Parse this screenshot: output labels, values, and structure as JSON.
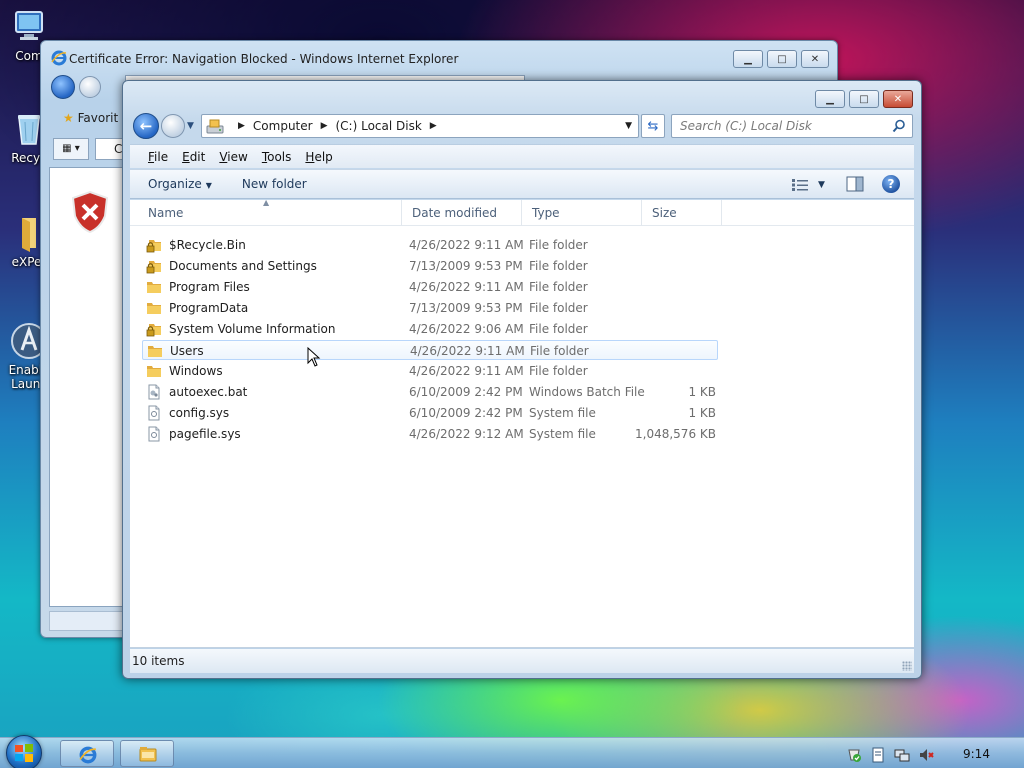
{
  "desktop": {
    "icons": [
      {
        "label": "Com",
        "icon": "computer-icon"
      },
      {
        "label": "Recyc",
        "icon": "recycle-bin-icon"
      },
      {
        "label": "eXPer",
        "icon": "folder-icon"
      },
      {
        "label": "Enable",
        "label2": "Launc",
        "icon": "app-launcher-icon"
      }
    ]
  },
  "ie_window": {
    "title": "Certificate Error: Navigation Blocked - Windows Internet Explorer",
    "favorites_label": "Favorit",
    "tab_label": "C",
    "error_icon": "shield-error-icon"
  },
  "explorer": {
    "breadcrumbs": [
      "Computer",
      "(C:) Local Disk"
    ],
    "search_placeholder": "Search (C:) Local Disk",
    "menu": [
      {
        "label": "File",
        "key": "F",
        "rest": "ile"
      },
      {
        "label": "Edit",
        "key": "E",
        "rest": "dit"
      },
      {
        "label": "View",
        "key": "V",
        "rest": "iew"
      },
      {
        "label": "Tools",
        "key": "T",
        "rest": "ools"
      },
      {
        "label": "Help",
        "key": "H",
        "rest": "elp"
      }
    ],
    "commands": {
      "organize": "Organize",
      "new_folder": "New folder"
    },
    "columns": {
      "name": "Name",
      "date": "Date modified",
      "type": "Type",
      "size": "Size"
    },
    "files": [
      {
        "name": "$Recycle.Bin",
        "date": "4/26/2022 9:11 AM",
        "type": "File folder",
        "size": "",
        "icon": "locked-folder-icon"
      },
      {
        "name": "Documents and Settings",
        "date": "7/13/2009 9:53 PM",
        "type": "File folder",
        "size": "",
        "icon": "locked-folder-icon"
      },
      {
        "name": "Program Files",
        "date": "4/26/2022 9:11 AM",
        "type": "File folder",
        "size": "",
        "icon": "folder-icon"
      },
      {
        "name": "ProgramData",
        "date": "7/13/2009 9:53 PM",
        "type": "File folder",
        "size": "",
        "icon": "folder-icon"
      },
      {
        "name": "System Volume Information",
        "date": "4/26/2022 9:06 AM",
        "type": "File folder",
        "size": "",
        "icon": "locked-folder-icon"
      },
      {
        "name": "Users",
        "date": "4/26/2022 9:11 AM",
        "type": "File folder",
        "size": "",
        "icon": "folder-icon"
      },
      {
        "name": "Windows",
        "date": "4/26/2022 9:11 AM",
        "type": "File folder",
        "size": "",
        "icon": "folder-icon"
      },
      {
        "name": "autoexec.bat",
        "date": "6/10/2009 2:42 PM",
        "type": "Windows Batch File",
        "size": "1 KB",
        "icon": "batch-file-icon"
      },
      {
        "name": "config.sys",
        "date": "6/10/2009 2:42 PM",
        "type": "System file",
        "size": "1 KB",
        "icon": "system-file-icon"
      },
      {
        "name": "pagefile.sys",
        "date": "4/26/2022 9:12 AM",
        "type": "System file",
        "size": "1,048,576 KB",
        "icon": "system-file-icon"
      }
    ],
    "hovered_row": "Users",
    "status": "10 items"
  },
  "taskbar": {
    "clock": "9:14",
    "pinned": [
      "internet-explorer-icon",
      "windows-explorer-icon"
    ],
    "tray": [
      "action-center-icon",
      "network-status-icon",
      "display-icon",
      "volume-muted-icon"
    ]
  },
  "colors": {
    "folder": "#f2c14e",
    "accent": "#2566c4",
    "close": "#c74b33"
  }
}
